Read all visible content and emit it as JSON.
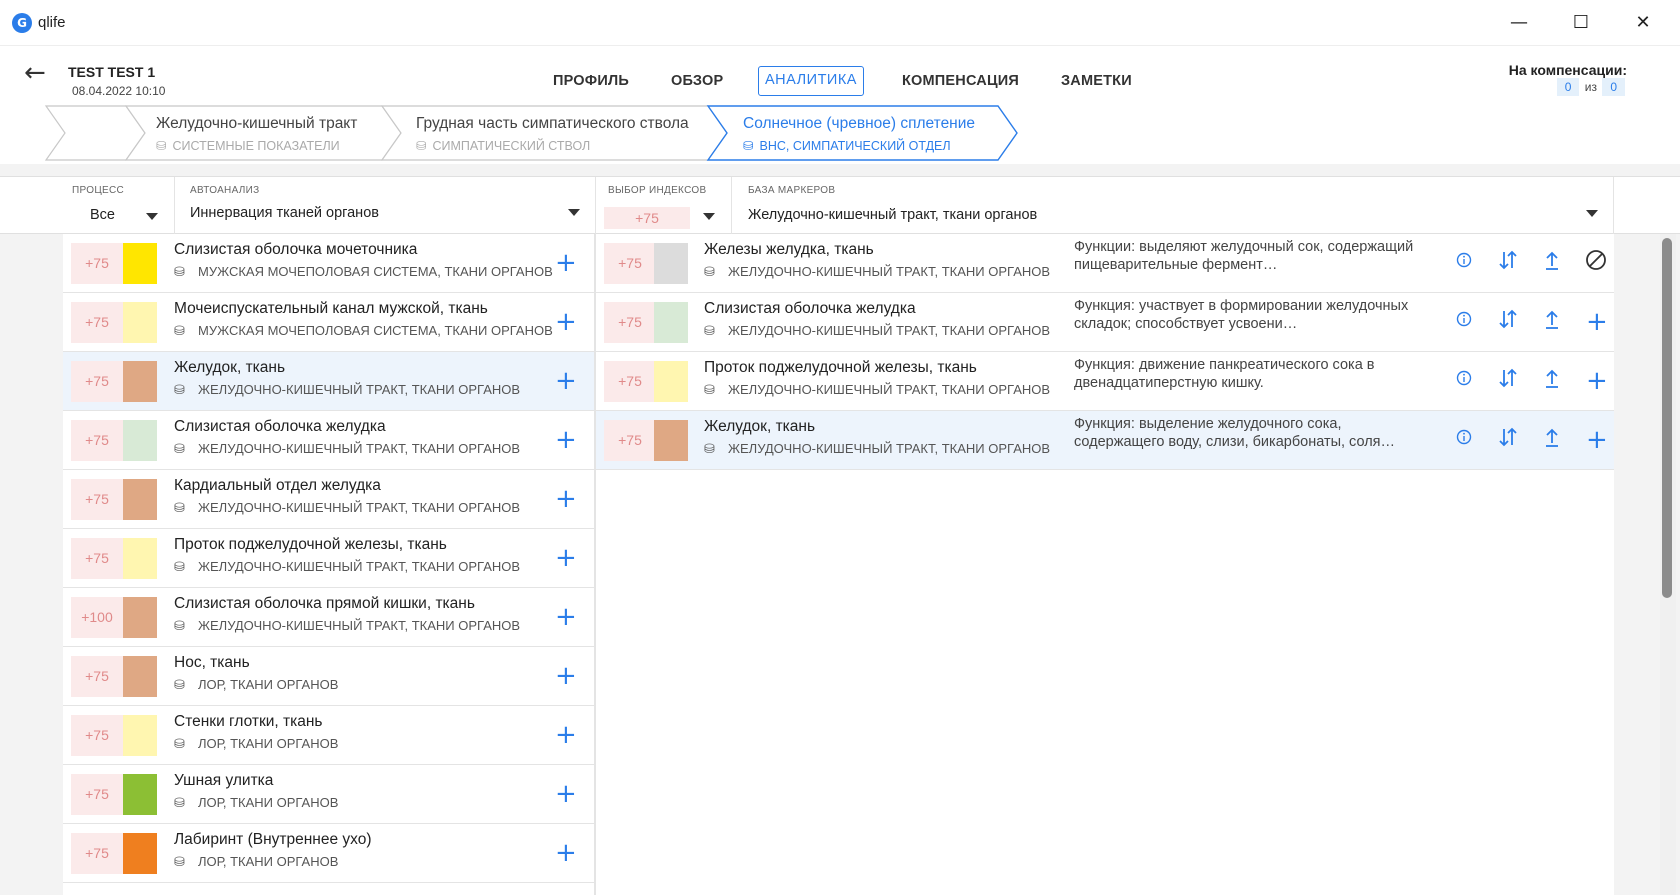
{
  "app": {
    "title": "qlife",
    "logo_letter": "G"
  },
  "window": {
    "minimize": "—",
    "maximize": "☐",
    "close": "✕"
  },
  "patient": {
    "name": "TEST TEST 1",
    "date": "08.04.2022 10:10",
    "back_label": "←"
  },
  "tabs": [
    {
      "label": "ПРОФИЛЬ",
      "active": false
    },
    {
      "label": "ОБЗОР",
      "active": false
    },
    {
      "label": "АНАЛИТИКА",
      "active": true
    },
    {
      "label": "КОМПЕНСАЦИЯ",
      "active": false
    },
    {
      "label": "ЗАМЕТКИ",
      "active": false
    }
  ],
  "compensation": {
    "label": "На компенсации:",
    "current": "0",
    "separator": "из",
    "total": "0"
  },
  "breadcrumbs": [
    {
      "title": "Желудочно-кишечный тракт",
      "subtitle": "СИСТЕМНЫЕ ПОКАЗАТЕЛИ",
      "active": false
    },
    {
      "title": "Грудная часть симпатического ствола",
      "subtitle": "СИМПАТИЧЕСКИЙ СТВОЛ",
      "active": false
    },
    {
      "title": "Солнечное (чревное) сплетение",
      "subtitle": "ВНС, СИМПАТИЧЕСКИЙ ОТДЕЛ",
      "active": true
    }
  ],
  "filters": {
    "process": {
      "label": "ПРОЦЕСС",
      "value": "Все"
    },
    "autoanalysis": {
      "label": "АВТОАНАЛИЗ",
      "value": "Иннервация тканей органов"
    },
    "index": {
      "label": "ВЫБОР ИНДЕКСОВ",
      "value": "+75"
    },
    "markers": {
      "label": "БАЗА МАРКЕРОВ",
      "value": "Желудочно-кишечный тракт, ткани органов"
    }
  },
  "colors": {
    "accent": "#2b7de9",
    "score_bg": "#fbeaea",
    "score_text": "#e08a8a",
    "selected_row": "#edf4fc"
  },
  "left_items": [
    {
      "score": "+75",
      "color": "#ffe600",
      "title": "Слизистая оболочка мочеточника",
      "subtitle": "Мужская мочеполовая система, ткани органов",
      "selected": false
    },
    {
      "score": "+75",
      "color": "#fff6b0",
      "title": "Мочеиспускательный канал мужской, ткань",
      "subtitle": "Мужская мочеполовая система, ткани органов",
      "selected": false
    },
    {
      "score": "+75",
      "color": "#dfa884",
      "title": "Желудок, ткань",
      "subtitle": "Желудочно-кишечный тракт, ткани органов",
      "selected": true
    },
    {
      "score": "+75",
      "color": "#d8ead6",
      "title": "Слизистая оболочка желудка",
      "subtitle": "Желудочно-кишечный тракт, ткани органов",
      "selected": false
    },
    {
      "score": "+75",
      "color": "#dfa884",
      "title": "Кардиальный отдел желудка",
      "subtitle": "Желудочно-кишечный тракт, ткани органов",
      "selected": false
    },
    {
      "score": "+75",
      "color": "#fff6b0",
      "title": "Проток поджелудочной железы, ткань",
      "subtitle": "Желудочно-кишечный тракт, ткани органов",
      "selected": false
    },
    {
      "score": "+100",
      "color": "#dfa884",
      "title": "Слизистая оболочка прямой кишки, ткань",
      "subtitle": "Желудочно-кишечный тракт, ткани органов",
      "selected": false
    },
    {
      "score": "+75",
      "color": "#dfa884",
      "title": "Нос, ткань",
      "subtitle": "ЛОР, ткани органов",
      "selected": false
    },
    {
      "score": "+75",
      "color": "#fff6b0",
      "title": "Стенки глотки, ткань",
      "subtitle": "ЛОР, ткани органов",
      "selected": false
    },
    {
      "score": "+75",
      "color": "#8cbf34",
      "title": "Ушная улитка",
      "subtitle": "ЛОР, ткани органов",
      "selected": false
    },
    {
      "score": "+75",
      "color": "#ef7f1f",
      "title": "Лабиринт (Внутреннее ухо)",
      "subtitle": "ЛОР, ткани органов",
      "selected": false
    }
  ],
  "right_items": [
    {
      "score": "+75",
      "color": "#dcdcdc",
      "title": "Железы желудка, ткань",
      "subtitle": "Желудочно-кишечный тракт, ткани органов",
      "func": "Функции: выделяют желудочный сок, содержащий пищеварительные фермент…",
      "action": "ban",
      "selected": false
    },
    {
      "score": "+75",
      "color": "#d8ead6",
      "title": "Слизистая оболочка желудка",
      "subtitle": "Желудочно-кишечный тракт, ткани органов",
      "func": "Функция: участвует в формировании желудочных складок; способствует усвоени…",
      "action": "plus",
      "selected": false
    },
    {
      "score": "+75",
      "color": "#fff6b0",
      "title": "Проток поджелудочной железы, ткань",
      "subtitle": "Желудочно-кишечный тракт, ткани органов",
      "func": "Функция: движение панкреатического сока в двенадцатиперстную кишку.",
      "action": "plus",
      "selected": false
    },
    {
      "score": "+75",
      "color": "#dfa884",
      "title": "Желудок, ткань",
      "subtitle": "Желудочно-кишечный тракт, ткани органов",
      "func": "Функция: выделение желудочного сока, содержащего воду, слизи, бикарбонаты, соля…",
      "action": "plus",
      "selected": true
    }
  ],
  "icons": {
    "info": "info-icon",
    "sort": "sort-icon",
    "upload": "upload-icon",
    "add": "plus-icon",
    "ban": "ban-icon",
    "database": "database-icon"
  }
}
